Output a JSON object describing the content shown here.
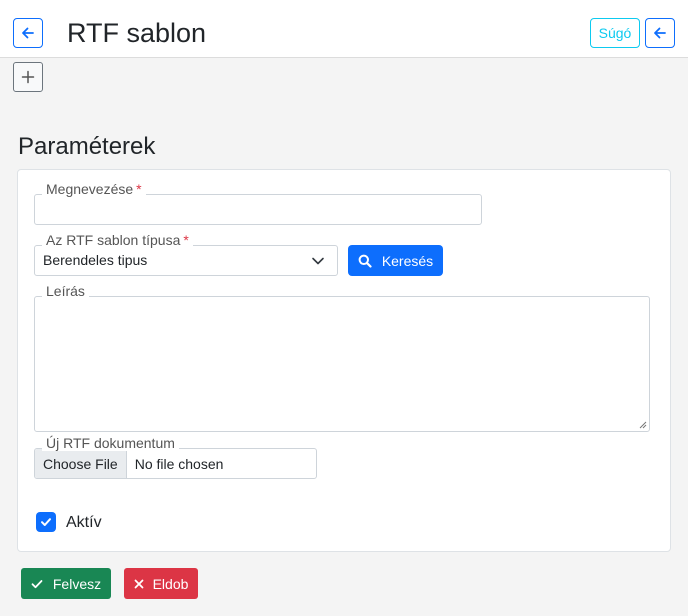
{
  "header": {
    "title": "RTF sablon",
    "help_label": "Súgó"
  },
  "section": {
    "title": "Paraméterek"
  },
  "form": {
    "name": {
      "label": "Megnevezése",
      "required_mark": "*",
      "value": ""
    },
    "type": {
      "label": "Az RTF sablon típusa",
      "required_mark": "*",
      "selected": "Berendeles tipus"
    },
    "search_label": "Keresés",
    "description": {
      "label": "Leírás",
      "value": ""
    },
    "file": {
      "label": "Új RTF dokumentum",
      "button_label": "Choose File",
      "status": "No file chosen"
    },
    "active": {
      "label": "Aktív",
      "checked": true
    }
  },
  "actions": {
    "save_label": "Felvesz",
    "discard_label": "Eldob"
  },
  "colors": {
    "primary": "#0d6efd",
    "info": "#0dcaf0",
    "success": "#198754",
    "danger": "#dc3545"
  },
  "icons": {
    "back": "arrow-left-icon",
    "add": "plus-icon",
    "dropdown": "chevron-down-icon",
    "search": "search-icon",
    "check": "check-icon",
    "close": "close-icon"
  }
}
